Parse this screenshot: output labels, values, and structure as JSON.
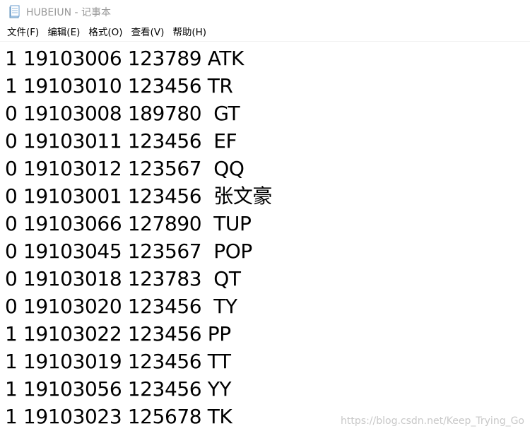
{
  "window": {
    "title": "HUBEIUN - 记事本"
  },
  "menu": {
    "items": [
      {
        "label": "文件(F)"
      },
      {
        "label": "编辑(E)"
      },
      {
        "label": "格式(O)"
      },
      {
        "label": "查看(V)"
      },
      {
        "label": "帮助(H)"
      }
    ]
  },
  "document": {
    "lines": [
      "1 19103006 123789 ATK",
      "1 19103010 123456 TR",
      "0 19103008 189780  GT",
      "0 19103011 123456  EF",
      "0 19103012 123567  QQ",
      "0 19103001 123456  张文豪",
      "0 19103066 127890  TUP",
      "0 19103045 123567  POP",
      "0 19103018 123783  QT",
      "0 19103020 123456  TY",
      "1 19103022 123456 PP",
      "1 19103019 123456 TT",
      "1 19103056 123456 YY",
      "1 19103023 125678 TK"
    ]
  },
  "watermark": {
    "text": "https://blog.csdn.net/Keep_Trying_Go"
  }
}
